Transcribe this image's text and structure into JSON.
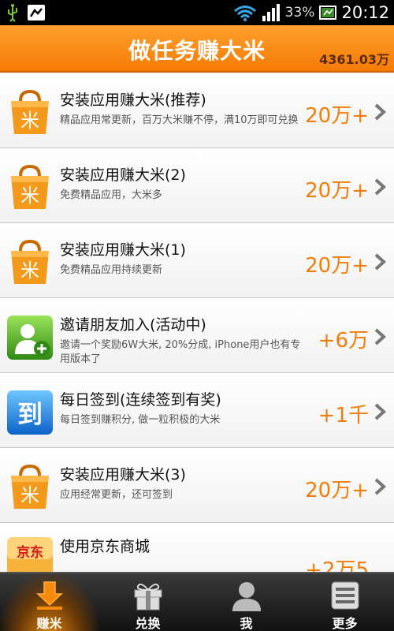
{
  "status_bar": {
    "battery_percent": "33%",
    "time": "20:12",
    "icons": [
      "usb-icon",
      "notification-icon",
      "wifi-icon",
      "signal-icon",
      "battery-icon"
    ]
  },
  "header": {
    "title": "做任务赚大米",
    "balance": "4361.03万"
  },
  "colors": {
    "accent": "#f57a06",
    "reward": "#f07d09",
    "nav_bg": "#1a1a1a"
  },
  "tasks": [
    {
      "title": "安装应用赚大米(推荐)",
      "desc": "精品应用常更新，百万大米赚不停，满10万即可兑换",
      "reward": "20万+",
      "icon": "shopping-bag-icon"
    },
    {
      "title": "安装应用赚大米(2)",
      "desc": "免费精品应用，大米多",
      "reward": "20万+",
      "icon": "shopping-bag-icon"
    },
    {
      "title": "安装应用赚大米(1)",
      "desc": "免费精品应用持续更新",
      "reward": "20万+",
      "icon": "shopping-bag-icon"
    },
    {
      "title": "邀请朋友加入(活动中)",
      "desc": "邀请一个奖励6W大米, 20%分成, iPhone用户也有专用版本了",
      "reward": "+6万",
      "icon": "invite-friend-icon"
    },
    {
      "title": "每日签到(连续签到有奖)",
      "desc": "每日签到赚积分, 做一粒积极的大米",
      "reward": "+1千",
      "icon": "checkin-icon",
      "icon_text": "到"
    },
    {
      "title": "安装应用赚大米(3)",
      "desc": "应用经常更新，还可签到",
      "reward": "20万+",
      "icon": "shopping-bag-icon"
    },
    {
      "title": "使用京东商城",
      "desc": "",
      "reward": "+2万5",
      "icon": "jd-logo-icon",
      "icon_text": "京东"
    }
  ],
  "bottom_nav": [
    {
      "label": "赚米",
      "icon": "download-arrow-icon",
      "active": true
    },
    {
      "label": "兑换",
      "icon": "gift-icon",
      "active": false
    },
    {
      "label": "我",
      "icon": "person-icon",
      "active": false
    },
    {
      "label": "更多",
      "icon": "menu-list-icon",
      "active": false
    }
  ]
}
